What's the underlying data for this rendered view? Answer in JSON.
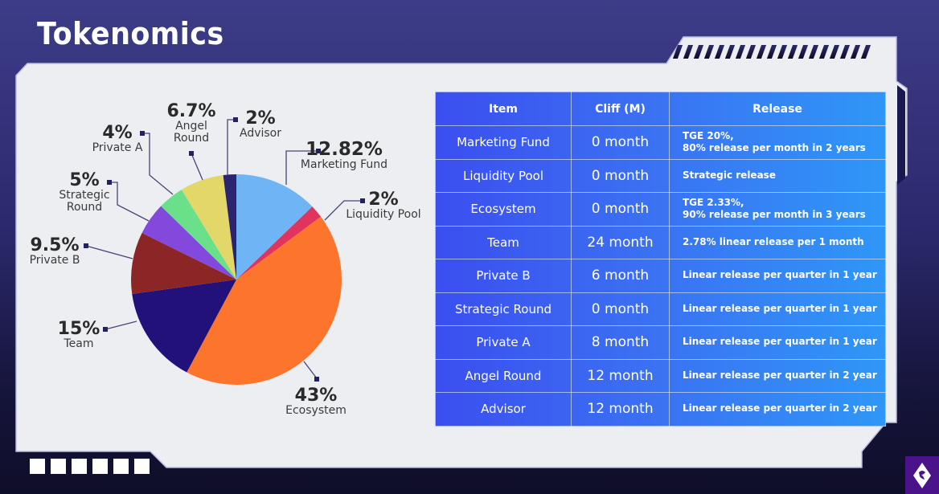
{
  "title": "Tokenomics",
  "colors": {
    "panel": "#edeef1",
    "leader_line": "#454578",
    "leader_dot": "#232260"
  },
  "chart_data": {
    "type": "pie",
    "title": "Tokenomics",
    "start_angle": "12 o'clock",
    "direction": "clockwise",
    "slices": [
      {
        "label": "Marketing Fund",
        "value": 12.82,
        "pct_text": "12.82%",
        "color": "#6fb5f6"
      },
      {
        "label": "Liquidity Pool",
        "value": 2,
        "pct_text": "2%",
        "color": "#e0335d"
      },
      {
        "label": "Ecosystem",
        "value": 43,
        "pct_text": "43%",
        "color": "#fd742d"
      },
      {
        "label": "Team",
        "value": 15,
        "pct_text": "15%",
        "color": "#22107b"
      },
      {
        "label": "Private B",
        "value": 9.5,
        "pct_text": "9.5%",
        "color": "#8b2526"
      },
      {
        "label": "Strategic Round",
        "value": 5,
        "pct_text": "5%",
        "color": "#8349dc"
      },
      {
        "label": "Private A",
        "value": 4,
        "pct_text": "4%",
        "color": "#69e089"
      },
      {
        "label": "Angel Round",
        "value": 6.7,
        "pct_text": "6.7%",
        "color": "#e3d76a"
      },
      {
        "label": "Advisor",
        "value": 2,
        "pct_text": "2%",
        "color": "#2d2470"
      }
    ],
    "labels": {
      "marketing": {
        "pct": "12.82%",
        "name": "Marketing Fund"
      },
      "liquidity": {
        "pct": "2%",
        "name": "Liquidity Pool"
      },
      "ecosystem": {
        "pct": "43%",
        "name": "Ecosystem"
      },
      "team": {
        "pct": "15%",
        "name": "Team"
      },
      "privateb": {
        "pct": "9.5%",
        "name": "Private B"
      },
      "strategic": {
        "pct": "5%",
        "name1": "Strategic",
        "name2": "Round"
      },
      "privatea": {
        "pct": "4%",
        "name": "Private A"
      },
      "angel": {
        "pct": "6.7%",
        "name1": "Angel",
        "name2": "Round"
      },
      "advisor": {
        "pct": "2%",
        "name": "Advisor"
      }
    }
  },
  "table": {
    "headers": [
      "Item",
      "Cliff (M)",
      "Release"
    ],
    "rows": [
      {
        "item": "Marketing Fund",
        "cliff": "0 month",
        "release1": "TGE 20%,",
        "release2": "80% release per month in 2 years"
      },
      {
        "item": "Liquidity Pool",
        "cliff": "0 month",
        "release1": "Strategic release",
        "release2": ""
      },
      {
        "item": "Ecosystem",
        "cliff": "0 month",
        "release1": "TGE 2.33%,",
        "release2": "90% release per month in 3 years"
      },
      {
        "item": "Team",
        "cliff": "24 month",
        "release1": "2.78% linear release per 1 month",
        "release2": ""
      },
      {
        "item": "Private B",
        "cliff": "6 month",
        "release1": "Linear release per quarter in 1 year",
        "release2": ""
      },
      {
        "item": "Strategic Round",
        "cliff": "0 month",
        "release1": "Linear release per quarter in 1 year",
        "release2": ""
      },
      {
        "item": "Private A",
        "cliff": "8 month",
        "release1": "Linear release per quarter in 1 year",
        "release2": ""
      },
      {
        "item": "Angel Round",
        "cliff": "12 month",
        "release1": "Linear release per quarter in 2 year",
        "release2": ""
      },
      {
        "item": "Advisor",
        "cliff": "12 month",
        "release1": "Linear release per quarter in 2 year",
        "release2": ""
      }
    ]
  },
  "decor": {
    "stripe_count": 19,
    "square_count": 6,
    "logo_icon": "diamond-logo-icon"
  }
}
